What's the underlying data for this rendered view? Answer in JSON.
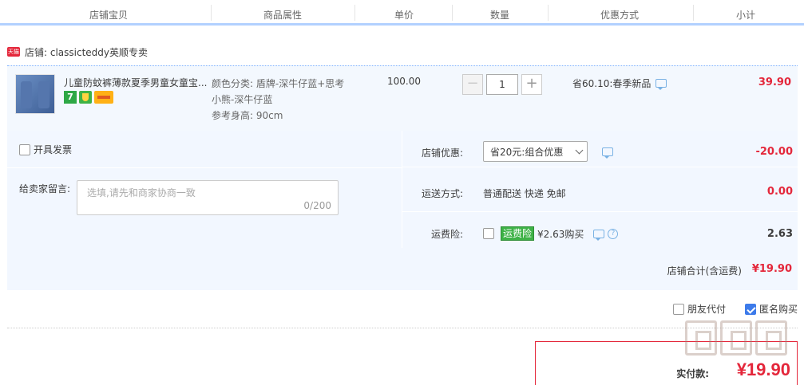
{
  "header": {
    "columns": [
      "店铺宝贝",
      "商品属性",
      "单价",
      "数量",
      "优惠方式",
      "小计"
    ]
  },
  "shop": {
    "badge": "天猫",
    "label": "店铺: classicteddy英顺专卖"
  },
  "item": {
    "title": "儿童防蚊裤薄款夏季男童女童宝...",
    "icon_seven": "7",
    "attr_color": "颜色分类: 盾牌-深牛仔蓝+思考",
    "attr_color_cont": "小熊-深牛仔蓝",
    "attr_size": "参考身高: 90cm",
    "price": "100.00",
    "quantity": "1",
    "qty_minus": "−",
    "qty_plus": "+",
    "promo": "省60.10:春季新品",
    "subtotal": "39.90"
  },
  "order": {
    "invoice_label": "开具发票",
    "message_label": "给卖家留言:",
    "message_placeholder": "选填,请先和商家协商一致",
    "message_count": "0/200",
    "shop_discount_label": "店铺优惠:",
    "shop_discount_value": "省20元:组合优惠",
    "shop_discount_amount": "-20.00",
    "shipping_label": "运送方式:",
    "shipping_value": "普通配送 快递 免邮",
    "shipping_amount": "0.00",
    "insurance_label": "运费险:",
    "insurance_tag": "运费险",
    "insurance_value": "¥2.63购买",
    "insurance_amount": "2.63",
    "total_label": "店铺合计(含运费)",
    "total_amount": "¥19.90"
  },
  "options": {
    "friend_pay": "朋友代付",
    "anonymous": "匿名购买"
  },
  "pay": {
    "label": "实付款:",
    "amount": "¥19.90"
  },
  "colors": {
    "accent_red": "#e4273b",
    "header_border": "#b2d1ff",
    "panel_bg": "#f2f7ff"
  }
}
